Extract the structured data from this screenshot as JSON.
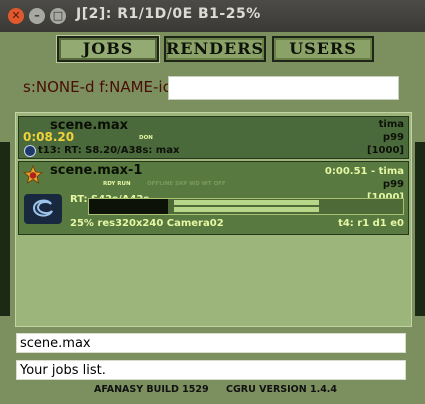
{
  "window": {
    "title": "J[2]: R1/1D/0E B1-25%"
  },
  "tabs": {
    "jobs": "JOBS",
    "renders": "RENDERS",
    "users": "USERS"
  },
  "filter": {
    "label": "s:NONE-d f:NAME-ic",
    "value": ""
  },
  "jobs": [
    {
      "name": "scene.max",
      "user": "tima",
      "time": "0:08.20",
      "state": "DON",
      "priority": "p99",
      "info": "t13: RT: S8.20/A38s: max",
      "count": "[1000]"
    },
    {
      "name": "scene.max-1",
      "user_time": "0:00.51 - tima",
      "state": "RDY RUN",
      "flags": "OFFLINE SKP WD WT OFF",
      "priority": "p99",
      "rt": "RT: S42s/A42s",
      "count": "[1000]",
      "progress_percent": 25,
      "details": "25% res320x240 Camera02",
      "task_info": "t4: r1 d1 e0"
    }
  ],
  "info_line1": "scene.max",
  "info_line2": "Your jobs list.",
  "footer": {
    "build": "AFANASY BUILD 1529",
    "version": "CGRU VERSION 1.4.4"
  },
  "colors": {
    "background": "#7b8f5f",
    "job_done": "#4b6a3c",
    "job_running": "#587a41",
    "accent_yellow": "#f0d23a"
  }
}
